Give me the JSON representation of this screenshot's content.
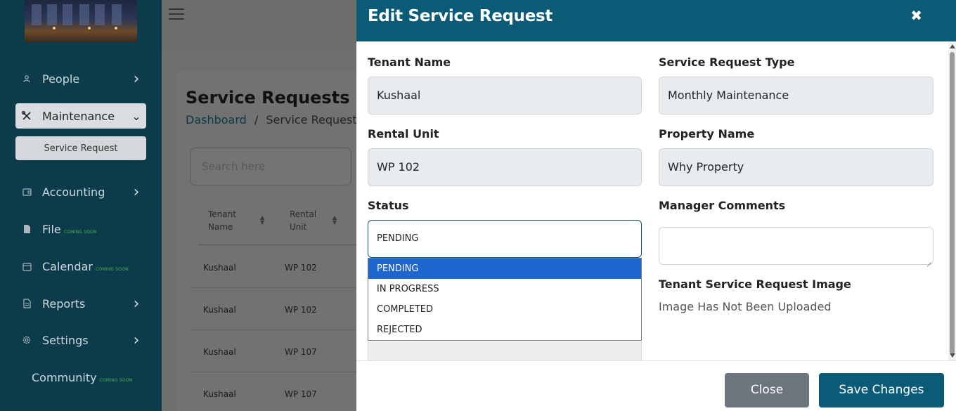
{
  "sidebar": {
    "items": [
      {
        "label": "People",
        "icon": "person-icon"
      },
      {
        "label": "Maintenance",
        "icon": "tools-icon"
      },
      {
        "label": "Accounting",
        "icon": "wallet-icon"
      },
      {
        "label": "File",
        "icon": "file-icon",
        "badge": "COMING SOON"
      },
      {
        "label": "Calendar",
        "icon": "calendar-icon",
        "badge": "COMING SOON"
      },
      {
        "label": "Reports",
        "icon": "report-icon"
      },
      {
        "label": "Settings",
        "icon": "gear-icon"
      },
      {
        "label": "Community",
        "badge": "COMING SOON"
      }
    ],
    "sub_item": "Service Request"
  },
  "page": {
    "title": "Service Requests",
    "breadcrumb_home": "Dashboard",
    "breadcrumb_sep": "/",
    "breadcrumb_current": "Service Requests",
    "search_placeholder": "Search here",
    "table": {
      "headers": [
        "Tenant Name",
        "Rental Unit"
      ],
      "rows": [
        [
          "Kushaal",
          "WP 102"
        ],
        [
          "Kushaal",
          "WP 102"
        ],
        [
          "Kushaal",
          "WP 107"
        ],
        [
          "Kushaal",
          "WP 107"
        ]
      ]
    }
  },
  "modal": {
    "title": "Edit Service Request",
    "close_symbol": "✖",
    "fields": {
      "tenant_name": {
        "label": "Tenant Name",
        "value": "Kushaal"
      },
      "service_type": {
        "label": "Service Request Type",
        "value": "Monthly Maintenance"
      },
      "rental_unit": {
        "label": "Rental Unit",
        "value": "WP 102"
      },
      "property_name": {
        "label": "Property Name",
        "value": "Why Property"
      },
      "status": {
        "label": "Status",
        "value": "PENDING",
        "options": [
          "PENDING",
          "IN PROGRESS",
          "COMPLETED",
          "REJECTED"
        ]
      },
      "manager_comments": {
        "label": "Manager Comments",
        "value": ""
      },
      "image": {
        "label": "Tenant Service Request Image",
        "value": "Image Has Not Been Uploaded"
      }
    },
    "buttons": {
      "close": "Close",
      "save": "Save Changes"
    }
  },
  "colors": {
    "sidebar_bg": "#0c3c4b",
    "modal_header": "#0b5a76",
    "selected_option": "#1e66d0",
    "close_button": "#6c757d"
  }
}
